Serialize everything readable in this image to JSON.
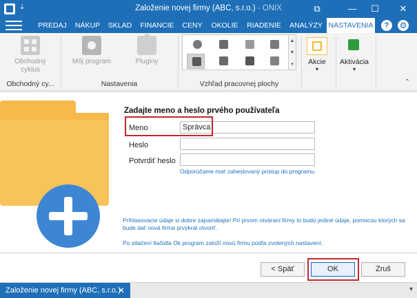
{
  "window": {
    "title": "Založenie novej firmy (ABC, s.r.o.)",
    "app": "ONIX",
    "title_separator": " - ",
    "qa_arrow": "⇣",
    "restore_icon": "⧉",
    "minimize_icon": "—",
    "maximize_icon": "☐",
    "close_icon": "✕"
  },
  "menu": {
    "items": [
      {
        "label": "PREDAJ"
      },
      {
        "label": "NÁKUP"
      },
      {
        "label": "SKLAD"
      },
      {
        "label": "FINANCIE"
      },
      {
        "label": "CENY"
      },
      {
        "label": "OKOLIE"
      },
      {
        "label": "RIADENIE"
      },
      {
        "label": "ANALÝZY"
      },
      {
        "label": "NASTAVENIA",
        "active": true
      }
    ],
    "help_label": "?",
    "settings_icon_label": "⚙"
  },
  "ribbon": {
    "btn_cycle": "Obchodný cyklus",
    "btn_cycle_line1": "Obchodný",
    "btn_cycle_line2": "cyklus",
    "btn_my_program": "Môj program",
    "btn_plugins": "Pluginy",
    "btn_actions": "Akcie",
    "btn_activation": "Aktivácia",
    "dropdown_arrow": "▾",
    "collapse_arrow": "⌃",
    "scroll_up": "▲",
    "scroll_down": "▼",
    "scroll_more": "▾",
    "groups": {
      "cycle": "Obchodný cy...",
      "settings": "Nastavenia",
      "desktop": "Vzhľad pracovnej plochy"
    }
  },
  "form": {
    "heading": "Zadajte meno a heslo prvého používateľa",
    "name_label": "Meno",
    "name_value": "Správca",
    "password_label": "Heslo",
    "password_value": "",
    "confirm_label": "Potvrdiť heslo",
    "confirm_value": "",
    "hint": "Odporúčame mať zaheslovaný prístup do programu.",
    "note1_line1": "Prihlasovacie údaje si dobre zapamätajte! Pri prvom otváraní firmy to budú jediné údaje, pomocou ktorých sa",
    "note1_line2": "bude dať nová firma prvýkrát otvoriť.",
    "note2": "Po stlačení tlačidla Ok program založí novú firmu podľa zvolených nastavení."
  },
  "buttons": {
    "back": "< Späť",
    "ok": "OK",
    "cancel": "Zruš"
  },
  "tabs": {
    "doc_tab": "Založenie novej firmy (ABC, s.r.o.)",
    "close": "✕",
    "chevron": "▾"
  },
  "colors": {
    "brand": "#1e6fb8",
    "highlight": "#c0272d",
    "folder": "#f6b94a",
    "plus_circle": "#3d86d4"
  }
}
